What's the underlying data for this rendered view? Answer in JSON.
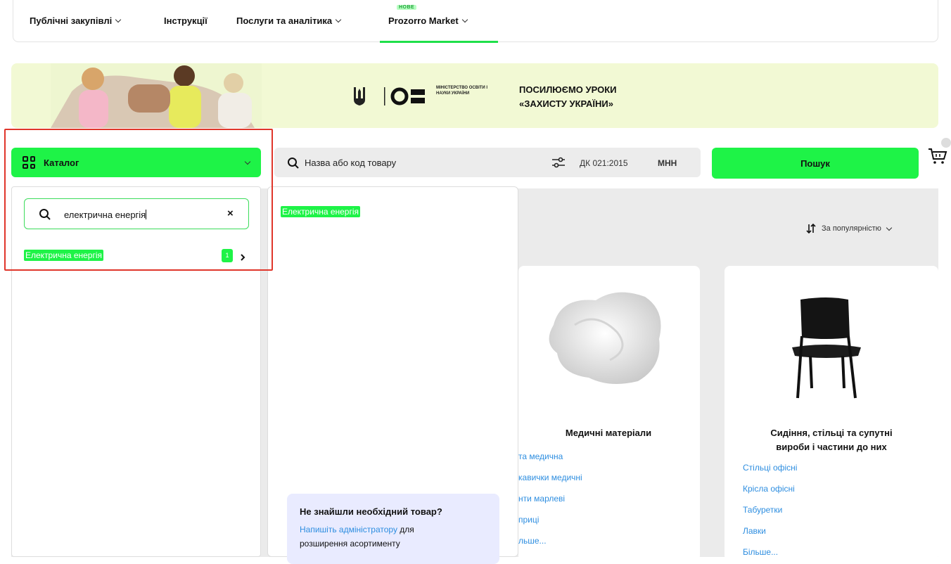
{
  "nav": {
    "items": [
      {
        "label": "Публічні закупівлі",
        "has_dropdown": true
      },
      {
        "label": "Інструкції",
        "has_dropdown": false
      },
      {
        "label": "Послуги та аналітика",
        "has_dropdown": true
      },
      {
        "label": "Prozorro Market",
        "has_dropdown": true
      }
    ],
    "new_badge": "НОВЕ"
  },
  "banner": {
    "ministry_text": "МІНІСТЕРСТВО ОСВІТИ І НАУКИ УКРАЇНИ",
    "title_line1": "ПОСИЛЮЄМО УРОКИ",
    "title_line2": "«ЗАХИСТУ УКРАЇНИ»"
  },
  "catalog": {
    "button_label": "Каталог",
    "search_query": "електрична енергія",
    "clear_icon": "×",
    "results": [
      {
        "label": "Електрична енергія",
        "count": "1"
      }
    ],
    "subresult": "Електрична енергія",
    "not_found": {
      "title": "Не знайшли необхідний товар?",
      "link": "Напишіть адміністратору",
      "text_after": " для",
      "text_line2": "розширення асортименту"
    }
  },
  "search": {
    "placeholder": "Назва або код товару",
    "dk_label": "ДК 021:2015",
    "mnn_label": "МНН",
    "button_label": "Пошук"
  },
  "sort": {
    "label": "За популярністю"
  },
  "products": [
    {
      "title": "Медичні матеріали",
      "links": [
        "та медична",
        "кавички медичні",
        "нти марлеві",
        "приці",
        "льше..."
      ]
    },
    {
      "title_line1": "Сидіння, стільці та супутні",
      "title_line2": "вироби і частини до них",
      "links": [
        "Стільці офісні",
        "Крісла офісні",
        "Табуретки",
        "Лавки",
        "Більше..."
      ]
    }
  ],
  "colors": {
    "accent": "#1ef347",
    "link": "#2e8ee0",
    "highlight_frame": "#e0362b",
    "banner_bg": "#f2f9d4"
  }
}
